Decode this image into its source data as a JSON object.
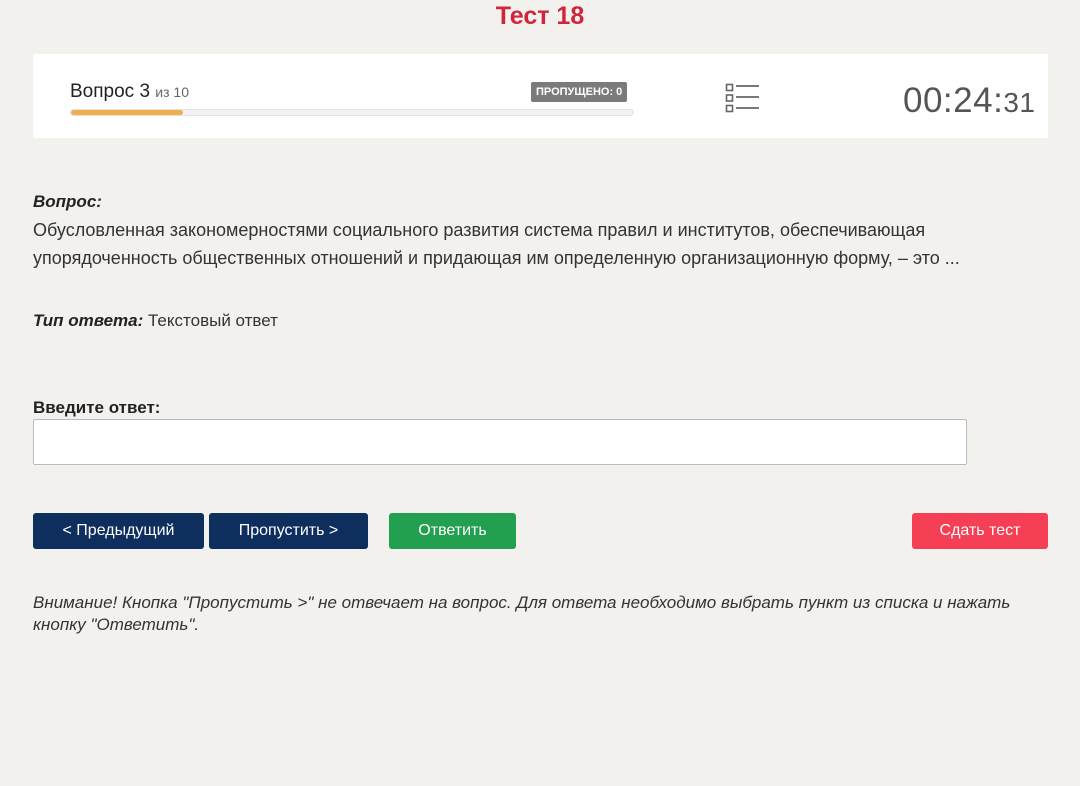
{
  "header": {
    "title": "Тест 18"
  },
  "status": {
    "question_label": "Вопрос 3",
    "question_of": "из 10",
    "skipped_badge": "ПРОПУЩЕНО: 0",
    "progress_fraction": 0.2,
    "timer_main": "00:24:",
    "timer_seconds": "31",
    "list_icon": "list-icon"
  },
  "question": {
    "label": "Вопрос:",
    "text": "Обусловленная закономерностями социального развития система правил и институтов, обеспечивающая упорядоченность общественных отношений и придающая им определенную организационную форму, – это ..."
  },
  "answer_type": {
    "label": "Тип ответа:",
    "value": "Текстовый ответ"
  },
  "answer_input": {
    "label": "Введите ответ:",
    "value": "",
    "placeholder": ""
  },
  "buttons": {
    "prev": "< Предыдущий",
    "skip": "Пропустить >",
    "answer": "Ответить",
    "submit": "Сдать тест"
  },
  "colors": {
    "title": "#d0253b",
    "progress": "#f0ad4e",
    "nav_button": "#0e2f5e",
    "answer_button": "#22a050",
    "submit_button": "#f43f55"
  },
  "notice": "Внимание! Кнопка \"Пропустить >\" не отвечает на вопрос. Для ответа необходимо выбрать пункт из списка и нажать кнопку \"Ответить\"."
}
